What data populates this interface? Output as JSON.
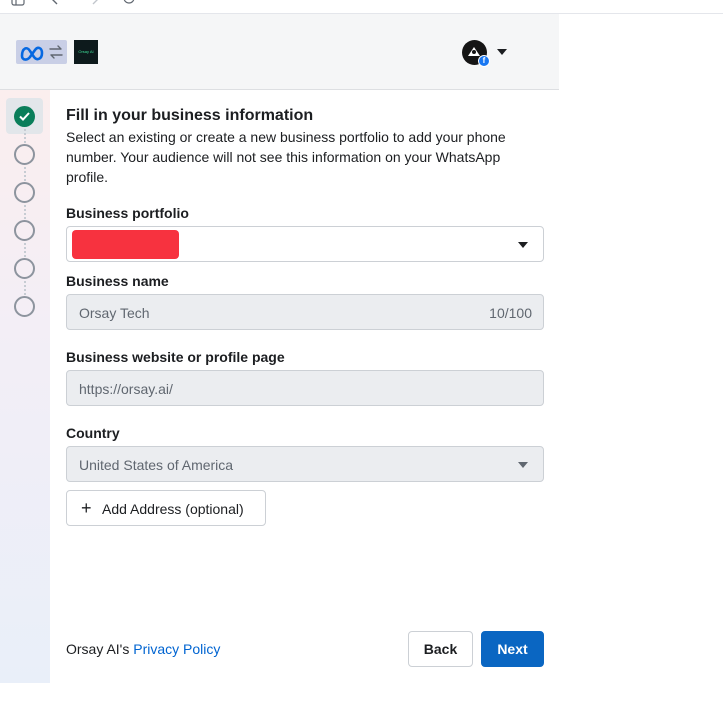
{
  "header": {
    "brand_tile_text": "Orsay AI",
    "icons": [
      "meta-logo-icon",
      "swap-icon",
      "avatar-icon",
      "facebook-badge-icon",
      "chevron-down-icon"
    ]
  },
  "stepper": {
    "steps": [
      {
        "state": "completed"
      },
      {
        "state": "pending"
      },
      {
        "state": "pending"
      },
      {
        "state": "pending"
      },
      {
        "state": "pending"
      },
      {
        "state": "pending"
      }
    ]
  },
  "form": {
    "title": "Fill in your business information",
    "description": "Select an existing or create a new business portfolio to add your phone number. Your audience will not see this information on your WhatsApp profile.",
    "business_portfolio": {
      "label": "Business portfolio",
      "value_redacted": true
    },
    "business_name": {
      "label": "Business name",
      "value": "Orsay Tech",
      "counter": "10/100"
    },
    "website": {
      "label": "Business website or profile page",
      "value": "https://orsay.ai/"
    },
    "country": {
      "label": "Country",
      "value": "United States of America"
    },
    "add_address_label": "Add Address (optional)"
  },
  "footer": {
    "owner_text": "Orsay AI's",
    "policy_link": "Privacy Policy",
    "back_label": "Back",
    "next_label": "Next"
  },
  "colors": {
    "primary": "#0a66c2",
    "step_done": "#0a7e5a",
    "redaction": "#f7323f",
    "link": "#0064d1"
  }
}
